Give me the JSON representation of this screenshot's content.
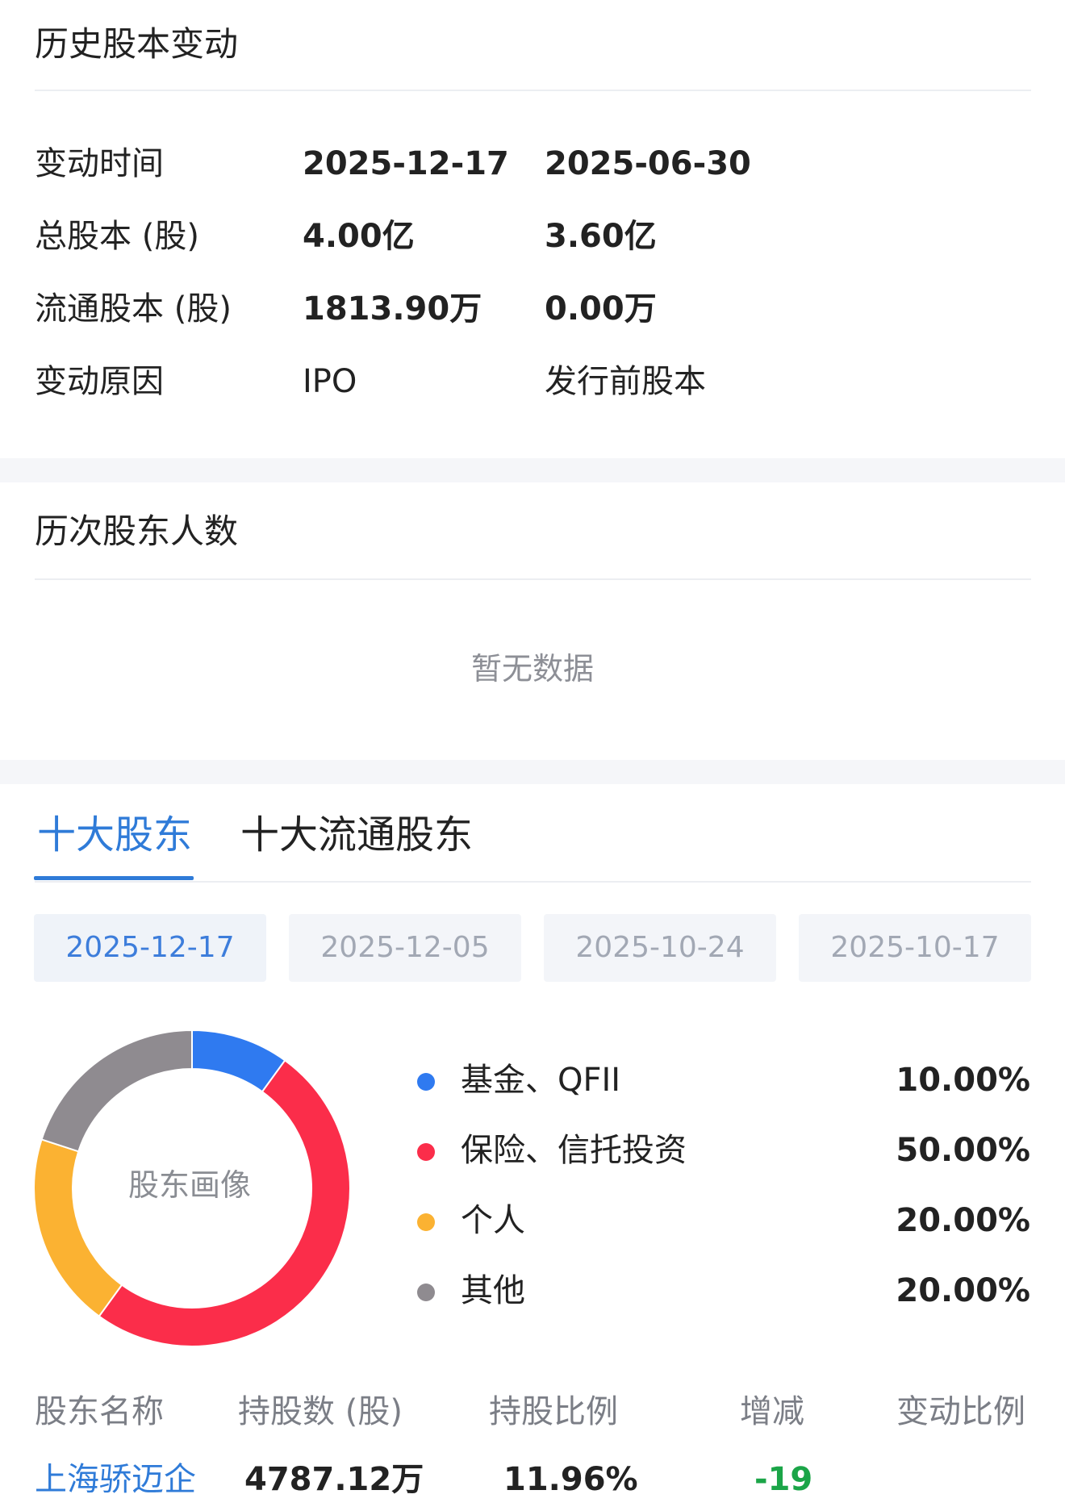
{
  "capital_change": {
    "title": "历史股本变动",
    "rows": [
      {
        "label": "变动时间",
        "v1": "2025-12-17",
        "v2": "2025-06-30"
      },
      {
        "label": "总股本 (股)",
        "v1": "4.00亿",
        "v2": "3.60亿"
      },
      {
        "label": "流通股本 (股)",
        "v1": "1813.90万",
        "v2": "0.00万"
      },
      {
        "label": "变动原因",
        "v1": "IPO",
        "v2": "发行前股本"
      }
    ]
  },
  "shareholder_count": {
    "title": "历次股东人数",
    "empty_text": "暂无数据"
  },
  "top_holders": {
    "tabs": [
      {
        "label": "十大股东",
        "active": true
      },
      {
        "label": "十大流通股东",
        "active": false
      }
    ],
    "dates": [
      "2025-12-17",
      "2025-12-05",
      "2025-10-24",
      "2025-10-17"
    ],
    "selected_date": "2025-12-17",
    "donut_center_label": "股东画像",
    "colors": {
      "accent": "#2f7bd8",
      "fund": "#2f7af0",
      "insurance": "#fb2d4a",
      "individual": "#fbb232",
      "other": "#8f8b90",
      "decrease": "#1ba548"
    },
    "table": {
      "headers": [
        "股东名称",
        "持股数 (股)",
        "持股比例",
        "增减",
        "变动比例"
      ],
      "rows": [
        {
          "name": "上海骄迈企",
          "shares": "4787.12万",
          "ratio": "11.96%",
          "change": "-19",
          "change_ratio": ""
        }
      ]
    }
  },
  "chart_data": {
    "type": "pie",
    "categories": [
      "基金、QFII",
      "保险、信托投资",
      "个人",
      "其他"
    ],
    "values": [
      10.0,
      50.0,
      20.0,
      20.0
    ],
    "labels": [
      "10.00%",
      "50.00%",
      "20.00%",
      "20.00%"
    ],
    "colors": [
      "#2f7af0",
      "#fb2d4a",
      "#fbb232",
      "#8f8b90"
    ],
    "legend": "right"
  }
}
